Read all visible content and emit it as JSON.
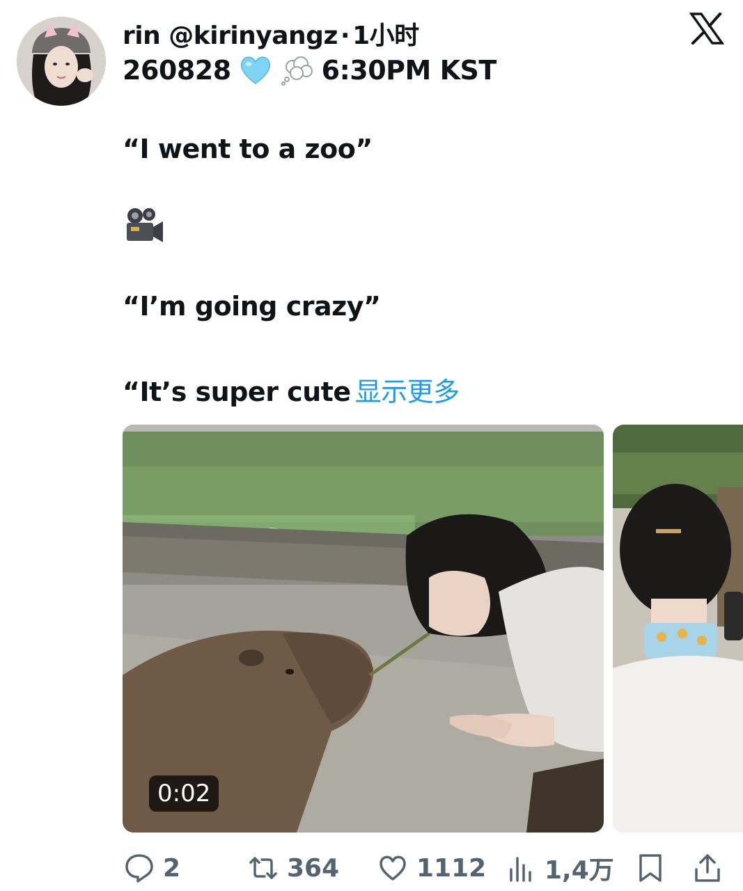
{
  "author": {
    "name": "rin",
    "handle": "@kirinyangz",
    "separator": "·",
    "time": "1小时"
  },
  "date_line": {
    "date": "260828",
    "time": "6:30PM KST",
    "emojis": [
      "light-blue-heart",
      "thought-balloon"
    ]
  },
  "tweet": {
    "line1": "“I went to a zoo”",
    "line2_emoji": "movie-camera",
    "line3": "“I’m going crazy”",
    "line4": "“It’s super cute",
    "show_more": "显示更多"
  },
  "media": {
    "video_duration": "0:02",
    "main_description_icon": "video-thumbnail",
    "side_description_icon": "photo-thumbnail"
  },
  "actions": {
    "replies": "2",
    "retweets": "364",
    "likes": "1112",
    "views": "1,4万"
  },
  "colors": {
    "text": "#0f1419",
    "muted": "#536471",
    "link": "#1d9bf0",
    "heart_emoji": "#7fd3f3"
  }
}
